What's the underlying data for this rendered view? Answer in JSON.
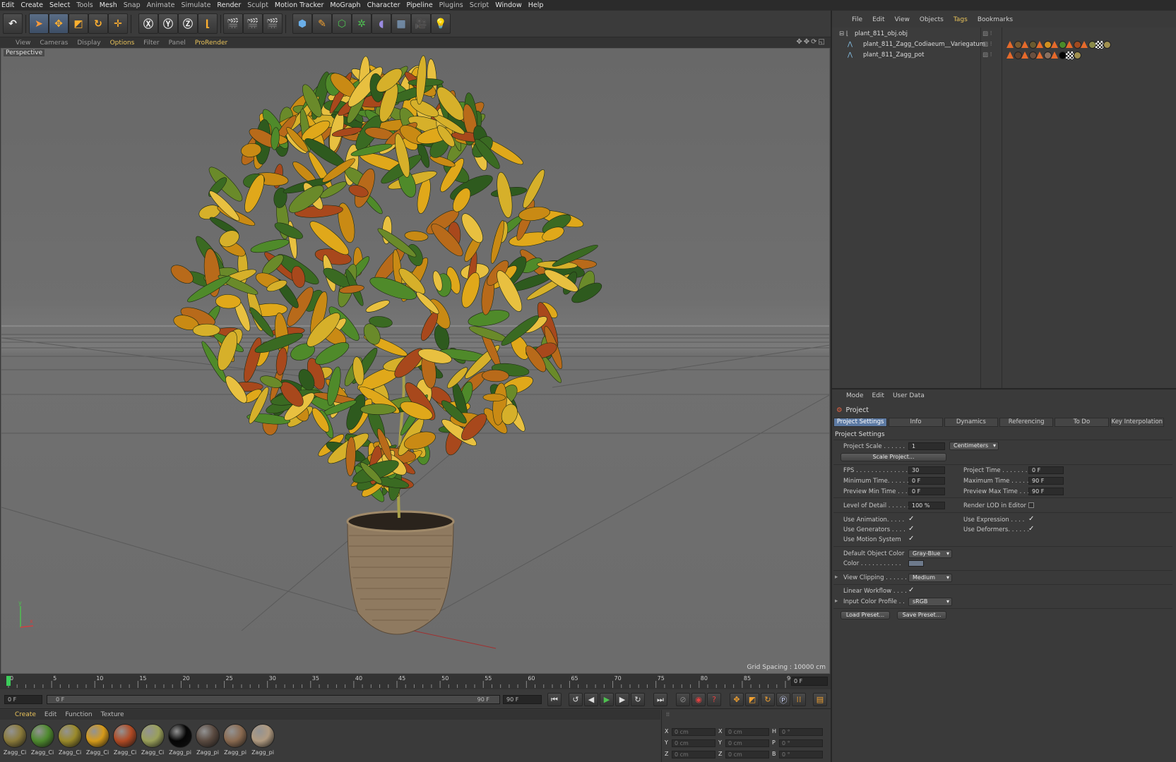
{
  "menubar": [
    "Edit",
    "Create",
    "Select",
    "Tools",
    "Mesh",
    "Snap",
    "Animate",
    "Simulate",
    "Render",
    "Sculpt",
    "Motion Tracker",
    "MoGraph",
    "Character",
    "Pipeline",
    "Plugins",
    "Script",
    "Window",
    "Help"
  ],
  "viewport": {
    "menus": [
      "View",
      "Cameras",
      "Display",
      "Options",
      "Filter",
      "Panel",
      "ProRender"
    ],
    "label": "Perspective",
    "grid_spacing": "Grid Spacing : 10000 cm",
    "axis_y": "y",
    "axis_x": "x"
  },
  "timeline": {
    "ticks": [
      "0",
      "5",
      "10",
      "15",
      "20",
      "25",
      "30",
      "35",
      "40",
      "45",
      "50",
      "55",
      "60",
      "65",
      "70",
      "75",
      "80",
      "85",
      "90"
    ],
    "current_frame": "0 F",
    "start_field": "0 F",
    "range_start": "0 F",
    "range_end": "90 F",
    "end_field": "90 F"
  },
  "materials": {
    "menus": [
      "Create",
      "Edit",
      "Function",
      "Texture"
    ],
    "items": [
      {
        "name": "Zagg_Ci",
        "color": "#8a7a3a"
      },
      {
        "name": "Zagg_Ci",
        "color": "#4e8a2e"
      },
      {
        "name": "Zagg_Ci",
        "color": "#9a8a2a"
      },
      {
        "name": "Zagg_Ci",
        "color": "#d59a1a"
      },
      {
        "name": "Zagg_Ci",
        "color": "#b04a24"
      },
      {
        "name": "Zagg_Ci",
        "color": "#9aa05a"
      },
      {
        "name": "Zagg_pi",
        "color": "#050505"
      },
      {
        "name": "Zagg_pi",
        "color": "#5a4a40"
      },
      {
        "name": "Zagg_pi",
        "color": "#8a6a50"
      },
      {
        "name": "Zagg_pi",
        "color": "#b09a80"
      }
    ]
  },
  "coordinates": {
    "rows": [
      {
        "a": "X",
        "av": "0 cm",
        "b": "X",
        "bv": "0 cm",
        "c": "H",
        "cv": "0 °"
      },
      {
        "a": "Y",
        "av": "0 cm",
        "b": "Y",
        "bv": "0 cm",
        "c": "P",
        "cv": "0 °"
      },
      {
        "a": "Z",
        "av": "0 cm",
        "b": "Z",
        "bv": "0 cm",
        "c": "B",
        "cv": "0 °"
      }
    ]
  },
  "object_manager": {
    "menus": [
      "File",
      "Edit",
      "View",
      "Objects",
      "Tags",
      "Bookmarks"
    ],
    "objects": [
      {
        "name": "plant_811_obj.obj"
      },
      {
        "name": "plant_811_Zagg_Codiaeum__Variegatum"
      },
      {
        "name": "plant_811_Zagg_pot"
      }
    ]
  },
  "attributes": {
    "menus": [
      "Mode",
      "Edit",
      "User Data"
    ],
    "title": "Project",
    "tabs": [
      "Project Settings",
      "Info",
      "Dynamics",
      "Referencing",
      "To Do",
      "Key Interpolation"
    ],
    "section": "Project Settings",
    "project_scale_label": "Project Scale . . . . . .",
    "project_scale_value": "1",
    "project_scale_unit": "Centimeters",
    "scale_project_btn": "Scale Project...",
    "fps_label": "FPS . . . . . . . . . . . . . .",
    "fps_value": "30",
    "project_time_label": "Project Time . . . . . . . .",
    "project_time_value": "0 F",
    "min_time_label": "Minimum Time. . . . . .",
    "min_time_value": "0 F",
    "max_time_label": "Maximum Time . . . . . .",
    "max_time_value": "90 F",
    "preview_min_label": "Preview Min Time . . .",
    "preview_min_value": "0 F",
    "preview_max_label": "Preview Max Time . . .",
    "preview_max_value": "90 F",
    "lod_label": "Level of Detail . . . . . .",
    "lod_value": "100 %",
    "render_lod_label": "Render LOD in Editor",
    "use_animation": "Use Animation. . . . .",
    "use_expression": "Use Expression . . . .",
    "use_generators": "Use Generators . . . .",
    "use_deformers": "Use Deformers. . . . . .",
    "use_motion": "Use Motion System",
    "default_color_label": "Default Object Color",
    "default_color_value": "Gray-Blue",
    "color_label": "Color . . . . . . . . . . .",
    "view_clipping_label": "View Clipping . . . . . .",
    "view_clipping_value": "Medium",
    "linear_workflow_label": "Linear Workflow . . . .",
    "input_profile_label": "Input Color Profile . .",
    "input_profile_value": "sRGB",
    "load_preset": "Load Preset...",
    "save_preset": "Save Preset..."
  }
}
